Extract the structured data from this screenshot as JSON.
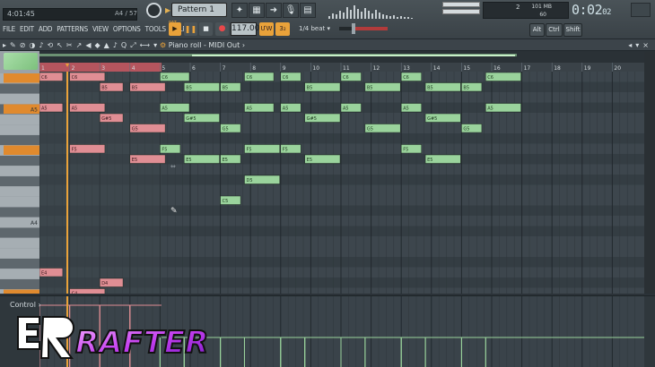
{
  "hint_bar": {
    "text": "4:01:45",
    "right": "A4 / 57"
  },
  "menu": [
    "FILE",
    "EDIT",
    "ADD",
    "PATTERNS",
    "VIEW",
    "OPTIONS",
    "TOOLS",
    "HELP"
  ],
  "toolbar": {
    "pattern": "Pattern 1",
    "tempo": "117.000",
    "snap": "1/4 beat",
    "pat_label": "PAT",
    "metro1": "ƯW",
    "metro2": "3₂",
    "cpu_top": "2",
    "cpu_mb": "101 MB",
    "cpu_val": "60",
    "time": "0:02",
    "time_small": "02",
    "modkeys": [
      "Alt",
      "Ctrl",
      "Shift"
    ]
  },
  "piano_roll": {
    "title": "Piano roll - MIDI Out",
    "tools": [
      "▸",
      "✎",
      "⊘",
      "◑",
      "♪",
      "⟲",
      "↖",
      "✂",
      "↗",
      "◀",
      "◆",
      "▲",
      "♪",
      "Q",
      "⤢",
      "⟷",
      "▾"
    ],
    "window_controls": [
      "◂",
      "▾",
      "×"
    ]
  },
  "ruler": {
    "bars": [
      "1",
      "2",
      "3",
      "4",
      "5",
      "6",
      "7",
      "8",
      "9",
      "10",
      "11",
      "12",
      "13",
      "14",
      "15",
      "16",
      "17",
      "18",
      "19",
      "20"
    ]
  },
  "keyboard_labels": [
    {
      "name": "A5",
      "row": 3
    },
    {
      "name": "A4",
      "row": 14
    }
  ],
  "notes": {
    "pink": [
      {
        "label": "C6",
        "row": 0,
        "start": 0.0,
        "len": 0.8
      },
      {
        "label": "C6",
        "row": 0,
        "start": 1.0,
        "len": 1.2
      },
      {
        "label": "B5",
        "row": 1,
        "start": 2.0,
        "len": 0.8
      },
      {
        "label": "B5",
        "row": 1,
        "start": 3.0,
        "len": 1.2
      },
      {
        "label": "A5",
        "row": 3,
        "start": 0.0,
        "len": 0.8
      },
      {
        "label": "A5",
        "row": 3,
        "start": 1.0,
        "len": 1.2
      },
      {
        "label": "G#5",
        "row": 4,
        "start": 2.0,
        "len": 0.8
      },
      {
        "label": "G5",
        "row": 5,
        "start": 3.0,
        "len": 1.2
      },
      {
        "label": "F5",
        "row": 7,
        "start": 1.0,
        "len": 1.2
      },
      {
        "label": "E5",
        "row": 8,
        "start": 3.0,
        "len": 1.2
      },
      {
        "label": "E4",
        "row": 19,
        "start": 0.0,
        "len": 0.8
      },
      {
        "label": "D4",
        "row": 20,
        "start": 2.0,
        "len": 0.8
      },
      {
        "label": "C4",
        "row": 21,
        "start": 1.0,
        "len": 1.2
      },
      {
        "label": "C4",
        "row": 22,
        "start": 3.0,
        "len": 1.2
      }
    ],
    "green": [
      {
        "label": "C6",
        "row": 0,
        "start": 4.0,
        "len": 1.0
      },
      {
        "label": "C6",
        "row": 0,
        "start": 6.8,
        "len": 1.0
      },
      {
        "label": "C6",
        "row": 0,
        "start": 8.0,
        "len": 0.7
      },
      {
        "label": "C6",
        "row": 0,
        "start": 10.0,
        "len": 0.7
      },
      {
        "label": "C6",
        "row": 0,
        "start": 12.0,
        "len": 0.7
      },
      {
        "label": "C6",
        "row": 0,
        "start": 14.8,
        "len": 1.2
      },
      {
        "label": "B5",
        "row": 1,
        "start": 4.8,
        "len": 1.2
      },
      {
        "label": "B5",
        "row": 1,
        "start": 6.0,
        "len": 0.7
      },
      {
        "label": "B5",
        "row": 1,
        "start": 8.8,
        "len": 1.2
      },
      {
        "label": "B5",
        "row": 1,
        "start": 10.8,
        "len": 1.2
      },
      {
        "label": "B5",
        "row": 1,
        "start": 12.8,
        "len": 1.2
      },
      {
        "label": "B5",
        "row": 1,
        "start": 14.0,
        "len": 0.7
      },
      {
        "label": "A5",
        "row": 3,
        "start": 4.0,
        "len": 1.0
      },
      {
        "label": "A5",
        "row": 3,
        "start": 6.8,
        "len": 1.0
      },
      {
        "label": "A5",
        "row": 3,
        "start": 8.0,
        "len": 0.7
      },
      {
        "label": "A5",
        "row": 3,
        "start": 10.0,
        "len": 0.7
      },
      {
        "label": "A5",
        "row": 3,
        "start": 12.0,
        "len": 0.7
      },
      {
        "label": "A5",
        "row": 3,
        "start": 14.8,
        "len": 1.2
      },
      {
        "label": "G#5",
        "row": 4,
        "start": 4.8,
        "len": 1.2
      },
      {
        "label": "G#5",
        "row": 4,
        "start": 8.8,
        "len": 1.2
      },
      {
        "label": "G#5",
        "row": 4,
        "start": 12.8,
        "len": 1.2
      },
      {
        "label": "G5",
        "row": 5,
        "start": 6.0,
        "len": 0.7
      },
      {
        "label": "G5",
        "row": 5,
        "start": 10.8,
        "len": 1.2
      },
      {
        "label": "G5",
        "row": 5,
        "start": 14.0,
        "len": 0.7
      },
      {
        "label": "F5",
        "row": 7,
        "start": 4.0,
        "len": 0.7
      },
      {
        "label": "F5",
        "row": 7,
        "start": 6.8,
        "len": 1.2
      },
      {
        "label": "F5",
        "row": 7,
        "start": 8.0,
        "len": 0.7
      },
      {
        "label": "F5",
        "row": 7,
        "start": 12.0,
        "len": 0.7
      },
      {
        "label": "E5",
        "row": 8,
        "start": 4.8,
        "len": 1.2
      },
      {
        "label": "E5",
        "row": 8,
        "start": 6.0,
        "len": 0.7
      },
      {
        "label": "E5",
        "row": 8,
        "start": 8.8,
        "len": 1.2
      },
      {
        "label": "E5",
        "row": 8,
        "start": 12.8,
        "len": 1.2
      },
      {
        "label": "D5",
        "row": 10,
        "start": 6.8,
        "len": 1.2
      },
      {
        "label": "C5",
        "row": 12,
        "start": 6.0,
        "len": 0.7
      }
    ]
  },
  "control": {
    "label": "Control"
  },
  "logo": {
    "text": "RAFTER"
  },
  "colors": {
    "pink": "#e08e94",
    "green": "#9ad39c",
    "accent": "#e9a23a"
  }
}
